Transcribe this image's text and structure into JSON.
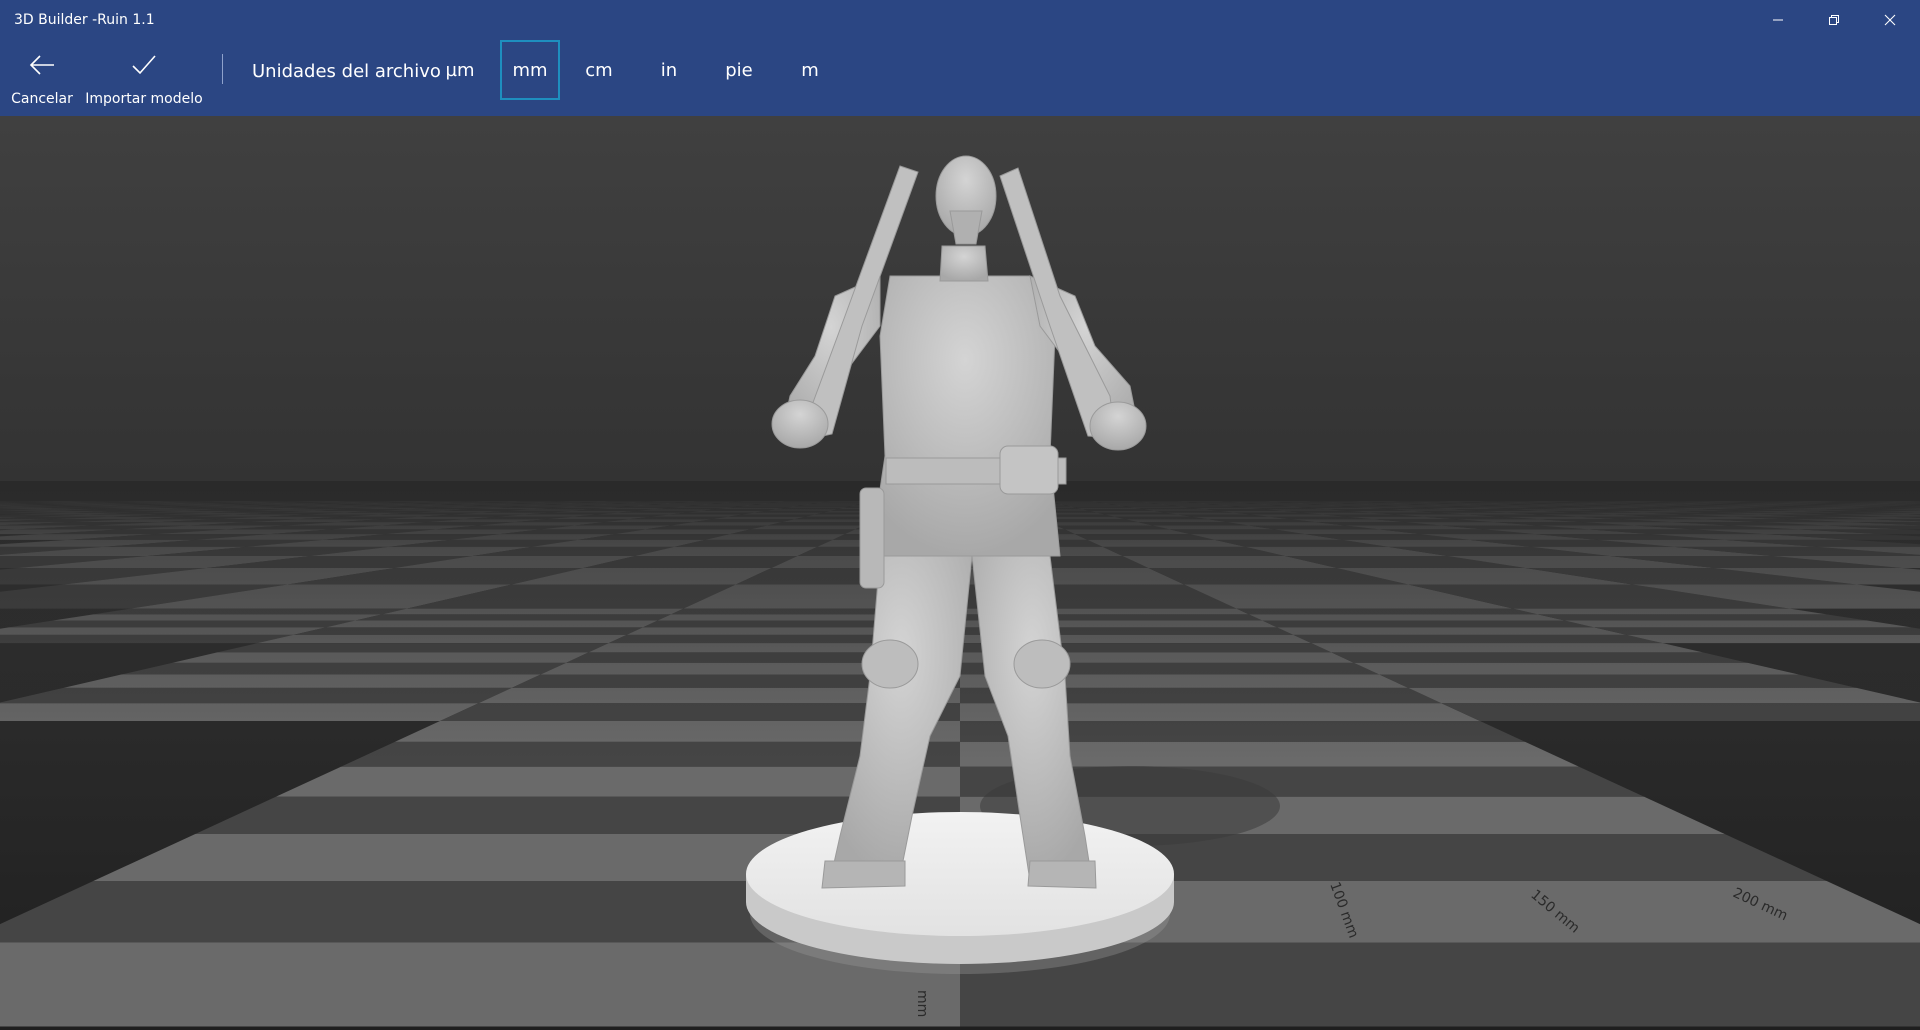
{
  "window": {
    "title": "3D Builder -Ruin 1.1",
    "controls": [
      "minimize-icon",
      "restore-icon",
      "close-icon"
    ]
  },
  "toolbar": {
    "cancel_label": "Cancelar",
    "import_label": "Importar modelo",
    "units_label": "Unidades del archivo",
    "units": [
      "µm",
      "mm",
      "cm",
      "in",
      "pie",
      "m"
    ],
    "selected_unit": "mm"
  },
  "viewport": {
    "ruler_labels": [
      "mm",
      "100 mm",
      "150 mm",
      "200 mm"
    ]
  },
  "colors": {
    "titlebar": "#2b4683",
    "selection": "#1e8fbf",
    "grid_dark": "#454545",
    "grid_light": "#6a6a6a"
  }
}
